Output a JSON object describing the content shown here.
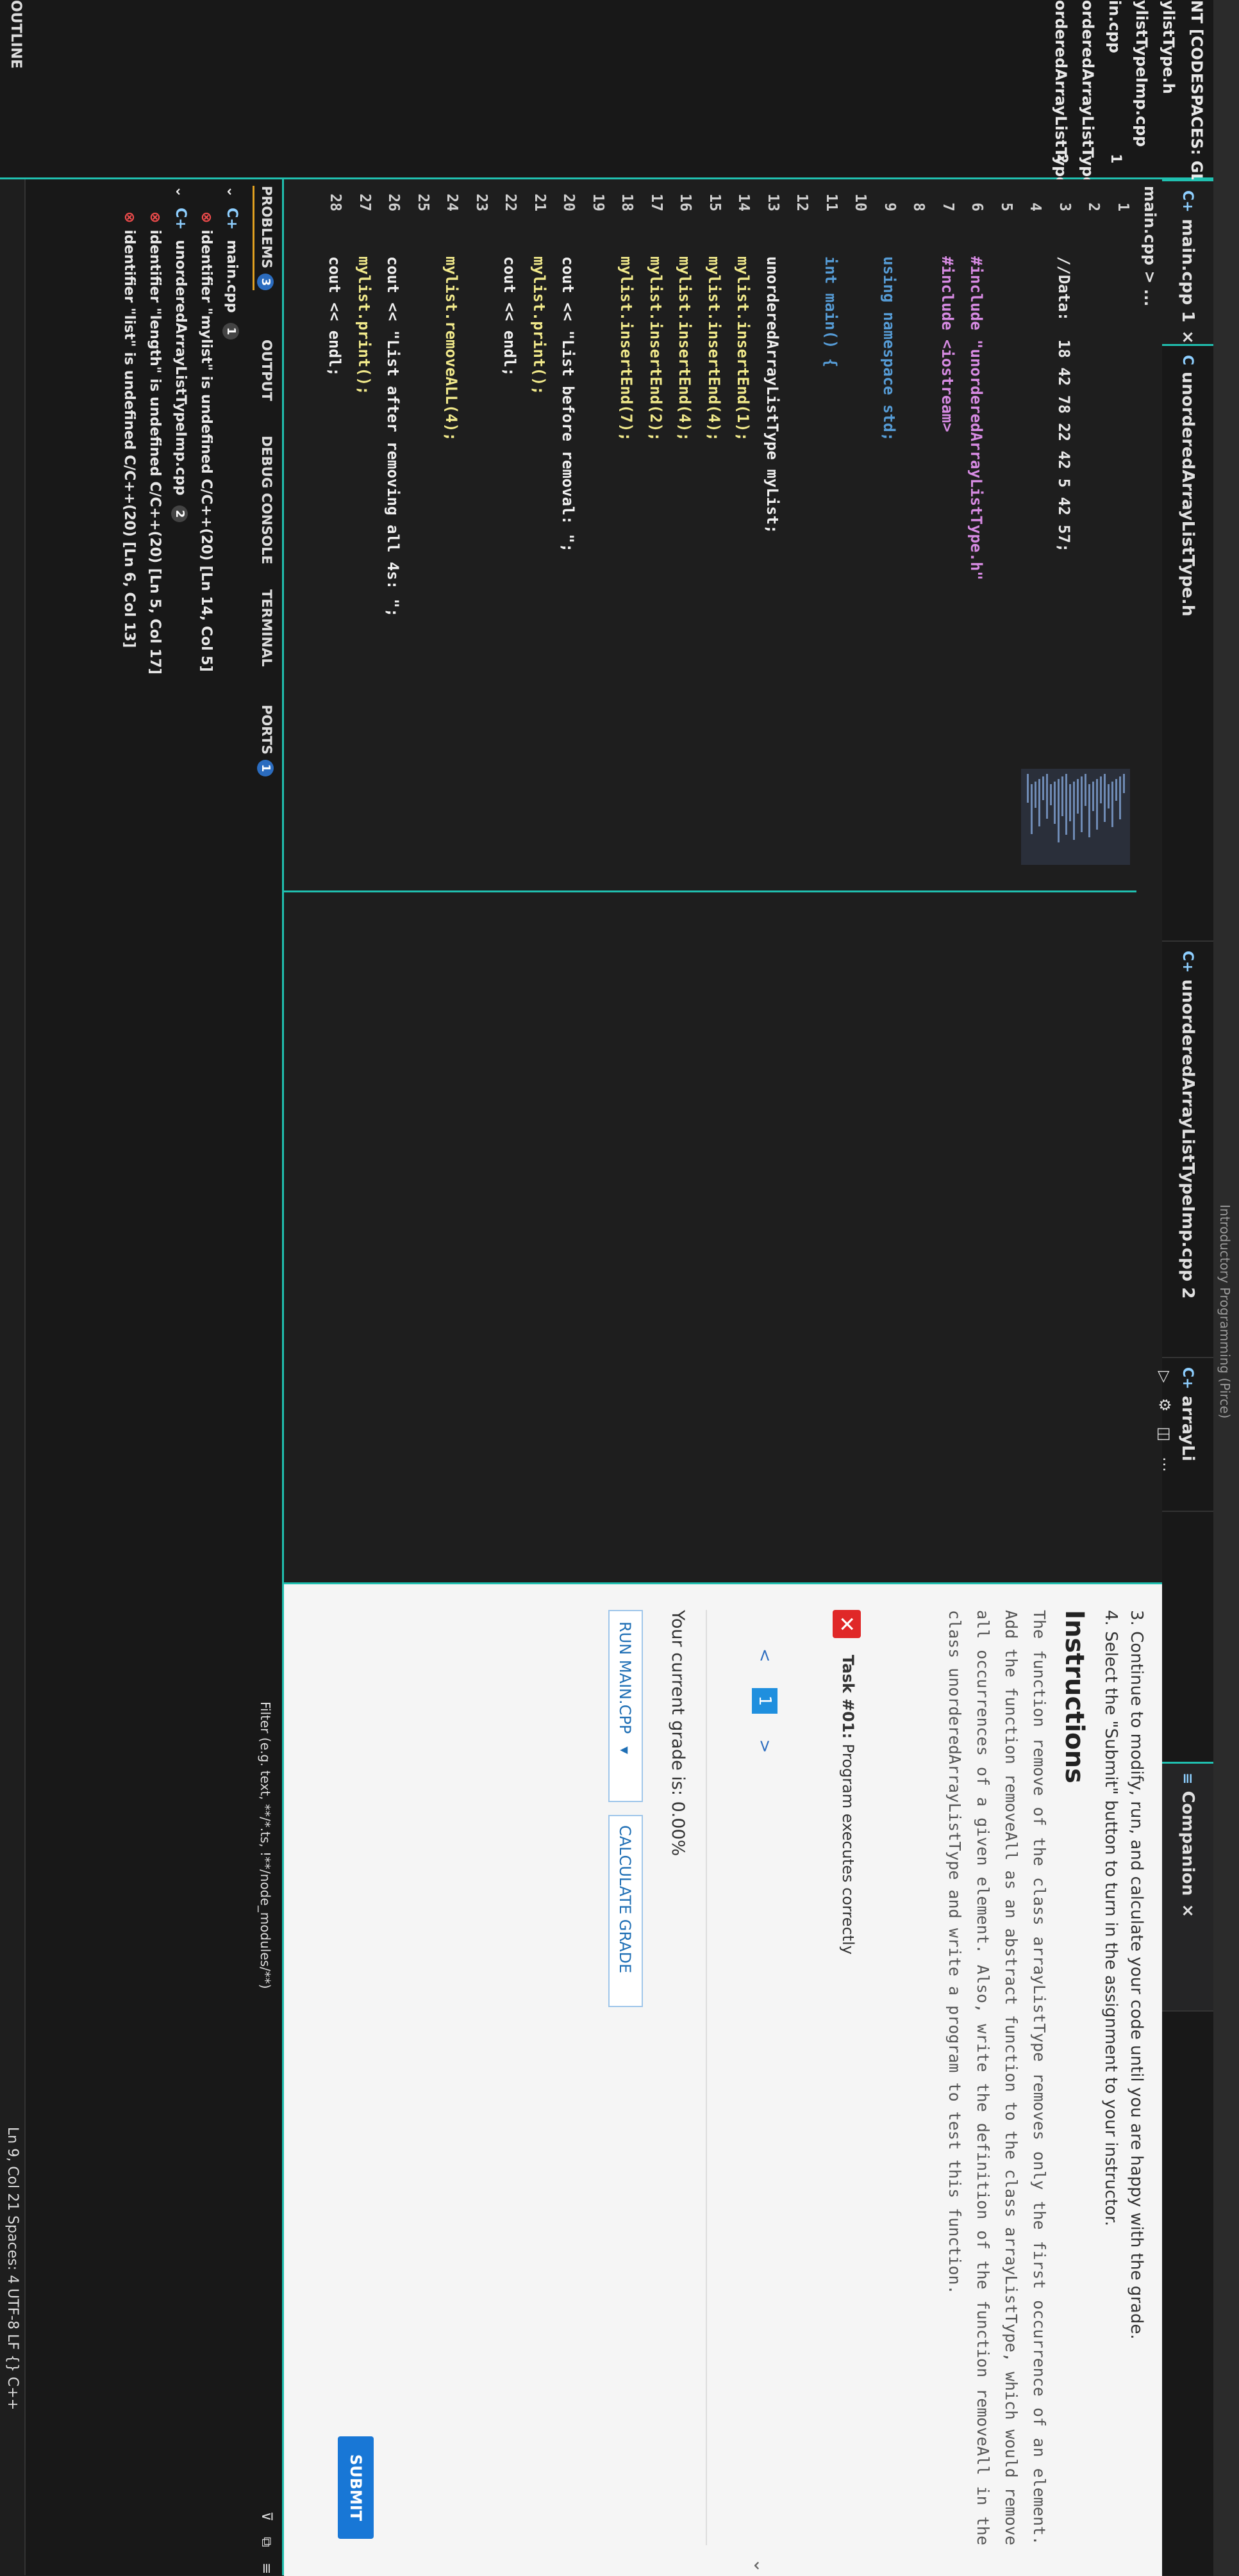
{
  "window": {
    "title": "Introductory Programming (Pirce)"
  },
  "explorer": {
    "header": "NT [CODESPACES: GLOWI...",
    "items": [
      {
        "label": "ylistType.h",
        "badge": ""
      },
      {
        "label": "ylistTypeImp.cpp",
        "badge": ""
      },
      {
        "label": "in.cpp",
        "badge": "1"
      },
      {
        "label": "orderedArrayListType.h",
        "badge": ""
      },
      {
        "label": "orderedArrayListTypeImp.cpp",
        "badge": "2"
      }
    ],
    "outline_label": "OUTLINE"
  },
  "tabs": [
    {
      "label": "main.cpp 1",
      "icon": "C+",
      "close": "×"
    },
    {
      "label": "unorderedArrayListType.h",
      "icon": "C"
    },
    {
      "label": "unorderedArrayListTypeImp.cpp 2",
      "icon": "C+"
    },
    {
      "label": "arrayLi",
      "icon": "C+"
    },
    {
      "label": "Companion",
      "icon": "≡",
      "close": "×"
    }
  ],
  "breadcrumb": "main.cpp > ...",
  "code_lines": [
    {
      "n": "1",
      "t": ""
    },
    {
      "n": "2",
      "t": ""
    },
    {
      "n": "3",
      "t": "//Data:  18 42 78 22 42 5 42 57;",
      "cls": "cmt"
    },
    {
      "n": "4",
      "t": ""
    },
    {
      "n": "5",
      "t": ""
    },
    {
      "n": "6",
      "t": "#include \"unorderedArrayListType.h\"",
      "cls": "pre"
    },
    {
      "n": "7",
      "t": "#include <iostream>",
      "cls": "pre"
    },
    {
      "n": "8",
      "t": ""
    },
    {
      "n": "9",
      "t": "using namespace std;",
      "cls": "kw"
    },
    {
      "n": "10",
      "t": ""
    },
    {
      "n": "11",
      "t": "int main() {",
      "cls": "kw"
    },
    {
      "n": "12",
      "t": ""
    },
    {
      "n": "13",
      "t": "unorderedArrayListType myList;"
    },
    {
      "n": "14",
      "t": "mylist.insertEnd(1);",
      "cls": "fn"
    },
    {
      "n": "15",
      "t": "mylist.insertEnd(4);",
      "cls": "fn"
    },
    {
      "n": "16",
      "t": "mylist.insertEnd(4);",
      "cls": "fn"
    },
    {
      "n": "17",
      "t": "mylist.insertEnd(2);",
      "cls": "fn"
    },
    {
      "n": "18",
      "t": "mylist.insertEnd(7);",
      "cls": "fn"
    },
    {
      "n": "19",
      "t": ""
    },
    {
      "n": "20",
      "t": "cout << \"List before removal: \";"
    },
    {
      "n": "21",
      "t": "mylist.print();",
      "cls": "fn"
    },
    {
      "n": "22",
      "t": "cout << endl;"
    },
    {
      "n": "23",
      "t": ""
    },
    {
      "n": "24",
      "t": "mylist.removeALL(4);",
      "cls": "fn"
    },
    {
      "n": "25",
      "t": ""
    },
    {
      "n": "26",
      "t": "cout << \"List after removing all 4s: \";"
    },
    {
      "n": "27",
      "t": "mylist.print();",
      "cls": "fn"
    },
    {
      "n": "28",
      "t": "cout << endl;"
    }
  ],
  "panel": {
    "tabs": {
      "problems": "PROBLEMS",
      "problems_count": "3",
      "output": "OUTPUT",
      "debug": "DEBUG CONSOLE",
      "terminal": "TERMINAL",
      "ports": "PORTS",
      "ports_count": "1"
    },
    "filter_placeholder": "Filter (e.g. text, **/*.ts, !**/node_modules/**)",
    "problems": [
      {
        "file": "main.cpp",
        "count": "1"
      },
      {
        "msg": "identifier \"mylist\" is undefined C/C++(20) [Ln 14, Col 5]"
      },
      {
        "file": "unorderedArrayListTypeImp.cpp",
        "count": "2"
      },
      {
        "msg": "identifier \"length\" is undefined C/C++(20) [Ln 5, Col 17]"
      },
      {
        "msg": "identifier \"list\" is undefined C/C++(20) [Ln 6, Col 13]"
      }
    ]
  },
  "companion": {
    "steps": [
      "3. Continue to modify, run, and calculate your code until you are happy with the grade.",
      "4. Select the \"Submit\" button to turn in the assignment to your instructor."
    ],
    "instructions_title": "Instructions",
    "instructions_body": "The function remove of the class arrayListType removes only the first occurrence of an element. Add the function removeAll as an abstract function to the class arrayListType, which would remove all occurrences of a given element. Also, write the definition of the function removeAll in the class unorderedArrayListType and write a program to test this function.",
    "task_label_bold": "Task #01:",
    "task_label": "Program executes correctly",
    "pager_prev": "<",
    "pager_page": "1",
    "pager_next": ">",
    "grade_text": "Your current grade is: 0.00%",
    "run_button": "RUN MAIN.CPP",
    "grade_button": "CALCULATE GRADE",
    "submit_button": "SUBMIT"
  },
  "status": {
    "right": "Ln 9, Col 21   Spaces: 4   UTF-8   LF   {} C++"
  }
}
